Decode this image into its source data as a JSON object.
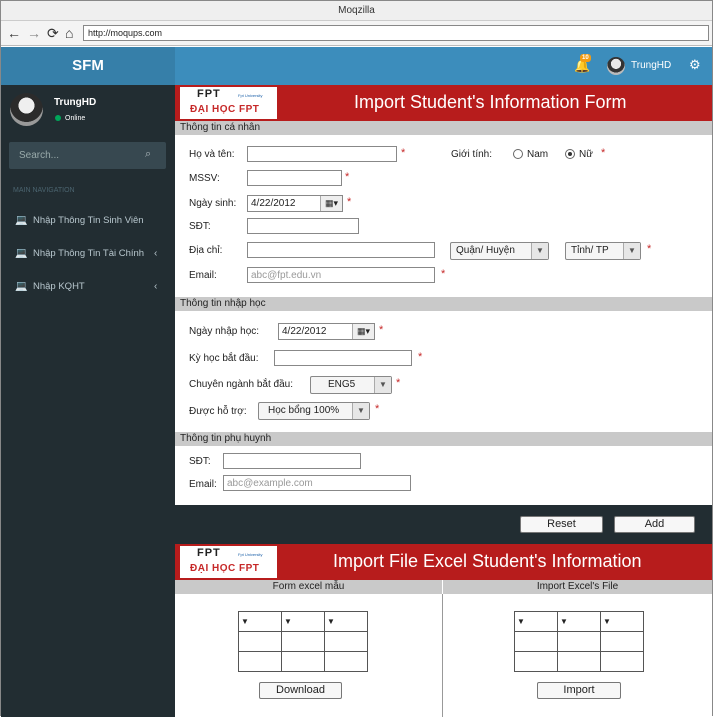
{
  "window": {
    "title": "Moqzilla"
  },
  "browser": {
    "url": "http://moqups.com",
    "back_icon": "←",
    "forward_icon": "→",
    "reload_icon": "⟳",
    "home_icon": "⌂"
  },
  "topbar": {
    "brand": "SFM",
    "notification_count": "10",
    "bell_icon": "🔔",
    "user_name": "TrungHD",
    "gear_icon": "⚙"
  },
  "sidebar": {
    "user_name": "TrungHD",
    "status": "Online",
    "search_placeholder": "Search...",
    "search_icon": "⌕",
    "nav_header": "MAIN NAVIGATION",
    "items": [
      {
        "label": "Nhập Thông Tin Sinh Viên",
        "icon": "laptop-icon",
        "glyph": "💻",
        "chevron": ""
      },
      {
        "label": "Nhập Thông Tin Tài Chính",
        "icon": "laptop-icon",
        "glyph": "💻",
        "chevron": "‹"
      },
      {
        "label": "Nhập KQHT",
        "icon": "laptop-icon",
        "glyph": "💻",
        "chevron": "‹"
      }
    ]
  },
  "logo": {
    "fpt": "FPT",
    "university": "Fpt University",
    "dhfpt": "ĐẠI HỌC FPT"
  },
  "form": {
    "title": "Import Student's Information Form",
    "required_mark": "*",
    "personal": {
      "section": "Thông tin cá nhân",
      "name_label": "Họ và tên:",
      "name_value": "",
      "gender_label": "Giới tính:",
      "gender_male": "Nam",
      "gender_female": "Nữ",
      "gender_selected": "Nữ",
      "mssv_label": "MSSV:",
      "mssv_value": "",
      "dob_label": "Ngày sinh:",
      "dob_value": "4/22/2012",
      "phone_label": "SĐT:",
      "phone_value": "",
      "address_label": "Địa chỉ:",
      "address_value": "",
      "district_select": "Quận/ Huyện",
      "province_select": "Tỉnh/ TP",
      "email_label": "Email:",
      "email_placeholder": "abc@fpt.edu.vn"
    },
    "enrollment": {
      "section": "Thông tin nhập học",
      "date_label": "Ngày nhập học:",
      "date_value": "4/22/2012",
      "term_label": "Kỳ học bắt đầu:",
      "term_value": "",
      "major_label": "Chuyên ngành bắt đầu:",
      "major_value": "ENG5",
      "support_label": "Được hỗ trợ:",
      "support_value": "Học bổng 100%"
    },
    "parent": {
      "section": "Thông tin phụ huynh",
      "phone_label": "SĐT:",
      "phone_value": "",
      "email_label": "Email:",
      "email_placeholder": "abc@example.com"
    },
    "reset_button": "Reset",
    "add_button": "Add"
  },
  "import": {
    "title": "Import File Excel Student's Information",
    "template_header": "Form excel mẫu",
    "upload_header": "Import Excel's File",
    "filter_glyph": "▼",
    "download_button": "Download",
    "import_button": "Import"
  },
  "colors": {
    "sidebar": "#222d32",
    "topbar": "#3c8dbc",
    "brand": "#367fa9",
    "header_red": "#b71c1c",
    "section_gray": "#c9c9c9",
    "required": "#c62828"
  }
}
